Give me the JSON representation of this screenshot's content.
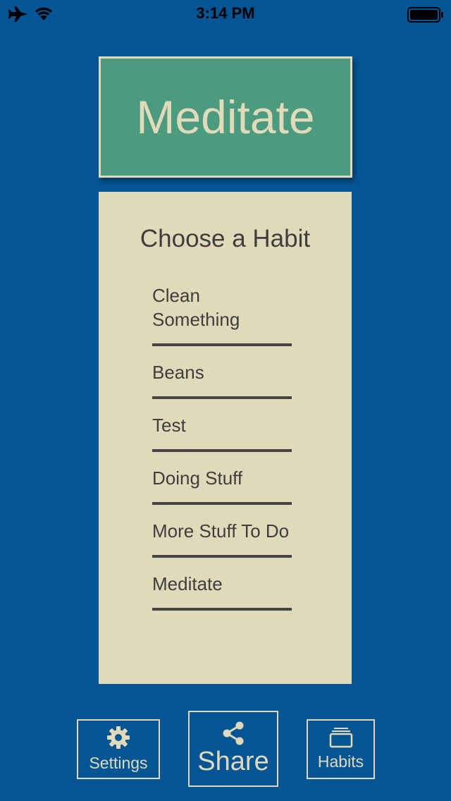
{
  "status_bar": {
    "time": "3:14 PM",
    "icons": [
      "airplane-icon",
      "wifi-icon",
      "battery-icon"
    ]
  },
  "title_card": {
    "text": "Meditate"
  },
  "chooser": {
    "heading": "Choose a Habit",
    "habits": [
      "Clean Something",
      "Beans",
      "Test",
      "Doing Stuff",
      "More Stuff To Do",
      "Meditate"
    ]
  },
  "toolbar": {
    "settings_label": "Settings",
    "share_label": "Share",
    "habits_label": "Habits"
  },
  "colors": {
    "background": "#045593",
    "card_green": "#4d9b7e",
    "cream": "#e0dabb",
    "text_dark": "#3e3e3e"
  }
}
